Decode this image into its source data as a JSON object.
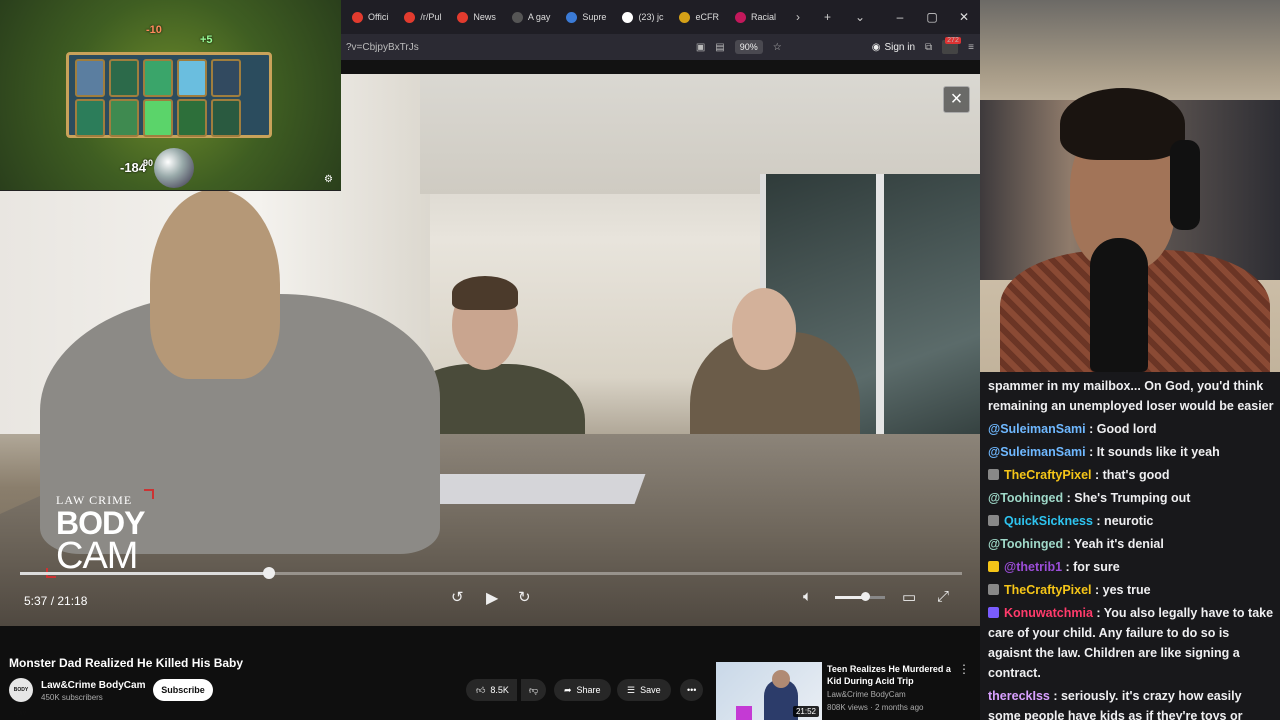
{
  "browser": {
    "tabs": [
      {
        "label": "Offici",
        "color": "#e23b2e"
      },
      {
        "label": "/r/Pul",
        "color": "#e23b2e"
      },
      {
        "label": "News",
        "color": "#e23b2e"
      },
      {
        "label": "A gay",
        "color": "#555555"
      },
      {
        "label": "Supre",
        "color": "#3b7bd6"
      },
      {
        "label": "(23) jc",
        "color": "#ffffff"
      },
      {
        "label": "eCFR",
        "color": "#d4a017"
      },
      {
        "label": "Racial",
        "color": "#c2185b"
      }
    ],
    "url": "?v=CbjpyBxTrJs",
    "zoom": "90%",
    "sign_in": "Sign in",
    "ext_count": "272"
  },
  "video": {
    "logo_line1": "LAW CRIME",
    "logo_line2": "BODY",
    "logo_line3": "CAM",
    "current_time": "5:37 / 21:18",
    "progress": 0.2642,
    "volume": 0.6
  },
  "meta": {
    "title": "Monster Dad Realized He Killed His Baby",
    "channel_avatar": "BODY CAM",
    "channel": "Law&Crime BodyCam",
    "subscribers": "450K subscribers",
    "subscribe": "Subscribe",
    "likes": "8.5K",
    "share": "Share",
    "save": "Save"
  },
  "recommended": {
    "title": "Teen Realizes He Murdered a Kid During Acid Trip",
    "channel": "Law&Crime BodyCam",
    "meta": "808K views · 2 months ago",
    "duration": "21:52"
  },
  "game": {
    "top_value": "-10",
    "top_bonus": "+5",
    "bottom_value": "-184",
    "bottom_sub": "90"
  },
  "chat": {
    "lines": [
      {
        "user": "",
        "text": "spammer in my mailbox... On God, you'd think remaining an unemployed loser would be easier",
        "color": "#efeff1",
        "badge": ""
      },
      {
        "user": "@SuleimanSami",
        "text": " : Good lord",
        "color": "#6fb8ff",
        "badge": ""
      },
      {
        "user": "@SuleimanSami",
        "text": " : It sounds like it yeah",
        "color": "#6fb8ff",
        "badge": ""
      },
      {
        "user": "TheCraftyPixel",
        "text": " : that's good",
        "color": "#f5c518",
        "badge": "#888888"
      },
      {
        "user": "@Toohinged",
        "text": " : She's Trumping out",
        "color": "#9fd8c8",
        "badge": ""
      },
      {
        "user": "QuickSickness",
        "text": " : neurotic",
        "color": "#2ec4f0",
        "badge": "#888888"
      },
      {
        "user": "@Toohinged",
        "text": " : Yeah it's denial",
        "color": "#9fd8c8",
        "badge": ""
      },
      {
        "user": "@thetrib1",
        "text": " : for sure",
        "color": "#9b4dd8",
        "badge": "#f5c518"
      },
      {
        "user": "TheCraftyPixel",
        "text": " : yes true",
        "color": "#f5c518",
        "badge": "#888888"
      },
      {
        "user": "Konuwatchmia",
        "text": " : You also legally have to take care of your child. Any failure to do so is agaisnt the law. Children are like signing a contract.",
        "color": "#ff3b6b",
        "badge": "#7a5cff"
      },
      {
        "user": "thereckIss",
        "text": " : seriously. it's crazy how easily some people have kids as if they're toys or something",
        "color": "#d8a0ff",
        "badge": ""
      }
    ]
  }
}
